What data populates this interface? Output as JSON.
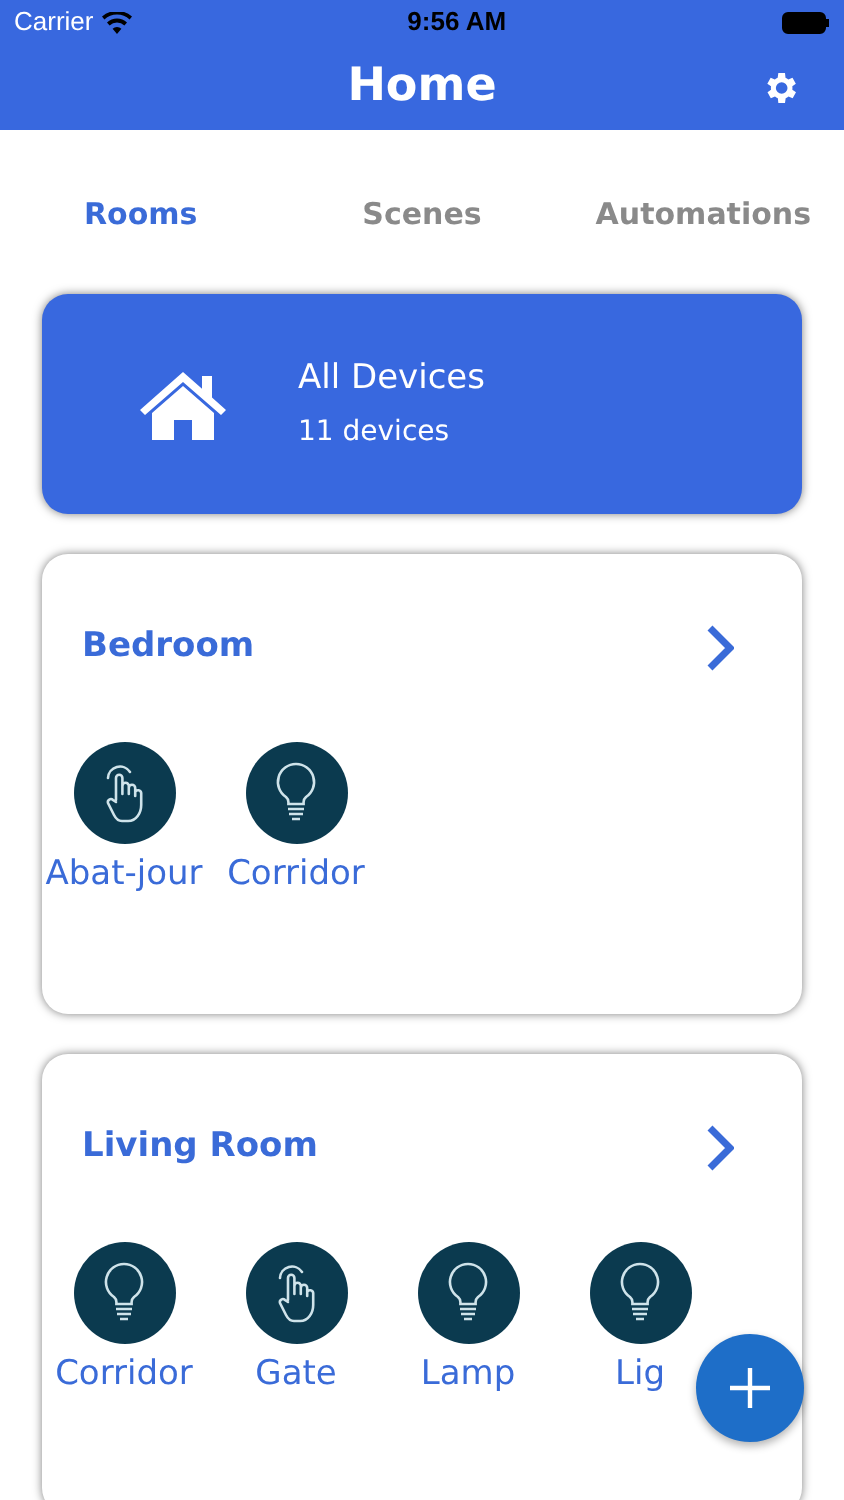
{
  "status_bar": {
    "carrier": "Carrier",
    "time": "9:56 AM"
  },
  "header": {
    "title": "Home"
  },
  "tabs": [
    {
      "label": "Rooms",
      "selected": true
    },
    {
      "label": "Scenes",
      "selected": false
    },
    {
      "label": "Automations",
      "selected": false
    }
  ],
  "all_devices": {
    "title": "All Devices",
    "count": "11 devices"
  },
  "rooms": [
    {
      "name": "Bedroom",
      "devices": [
        {
          "label": "Abat-jour",
          "kind": "button"
        },
        {
          "label": "Corridor",
          "kind": "light"
        }
      ]
    },
    {
      "name": "Living Room",
      "devices": [
        {
          "label": "Corridor",
          "kind": "light"
        },
        {
          "label": "Gate",
          "kind": "button"
        },
        {
          "label": "Lamp",
          "kind": "light"
        },
        {
          "label": "Lig",
          "kind": "light"
        }
      ]
    }
  ]
}
